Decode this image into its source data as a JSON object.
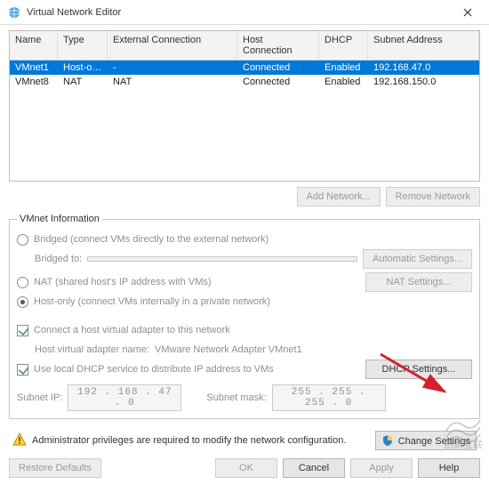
{
  "window": {
    "title": "Virtual Network Editor"
  },
  "grid": {
    "headers": {
      "name": "Name",
      "type": "Type",
      "ext": "External Connection",
      "host": "Host Connection",
      "dhcp": "DHCP",
      "sub": "Subnet Address"
    },
    "rows": [
      {
        "name": "VMnet1",
        "type": "Host-only",
        "ext": "-",
        "host": "Connected",
        "dhcp": "Enabled",
        "sub": "192.168.47.0",
        "selected": true
      },
      {
        "name": "VMnet8",
        "type": "NAT",
        "ext": "NAT",
        "host": "Connected",
        "dhcp": "Enabled",
        "sub": "192.168.150.0",
        "selected": false
      }
    ]
  },
  "buttons": {
    "add_network": "Add Network...",
    "remove_network": "Remove Network",
    "auto_settings": "Automatic Settings...",
    "nat_settings": "NAT Settings...",
    "dhcp_settings": "DHCP Settings...",
    "change_settings": "Change Settings",
    "restore": "Restore Defaults",
    "ok": "OK",
    "cancel": "Cancel",
    "apply": "Apply",
    "help": "Help"
  },
  "group": {
    "legend": "VMnet Information",
    "bridged": "Bridged (connect VMs directly to the external network)",
    "bridged_to_label": "Bridged to:",
    "bridged_to_value": "",
    "nat": "NAT (shared host's IP address with VMs)",
    "hostonly": "Host-only (connect VMs internally in a private network)",
    "connect_adapter": "Connect a host virtual adapter to this network",
    "adapter_name_label": "Host virtual adapter name:",
    "adapter_name_value": "VMware Network Adapter VMnet1",
    "use_dhcp": "Use local DHCP service to distribute IP address to VMs",
    "subnet_ip_label": "Subnet IP:",
    "subnet_ip_value": "192 . 168 . 47 . 0",
    "subnet_mask_label": "Subnet mask:",
    "subnet_mask_value": "255 . 255 . 255 . 0"
  },
  "info": {
    "msg": "Administrator privileges are required to modify the network configuration."
  }
}
